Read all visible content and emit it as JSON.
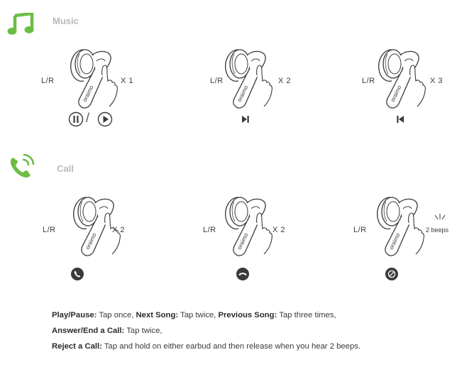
{
  "music": {
    "title": "Music",
    "items": [
      {
        "side": "L/R",
        "count": "X 1",
        "control": "pause-play"
      },
      {
        "side": "L/R",
        "count": "X 2",
        "control": "next"
      },
      {
        "side": "L/R",
        "count": "X 3",
        "control": "previous"
      }
    ],
    "separator": "/"
  },
  "call": {
    "title": "Call",
    "items": [
      {
        "side": "L/R",
        "count": "X 2",
        "control": "answer"
      },
      {
        "side": "L/R",
        "count": "X 2",
        "control": "end"
      },
      {
        "side": "L/R",
        "count": "2 beeps",
        "control": "reject"
      }
    ]
  },
  "earbud_brand": "oraimo",
  "description": {
    "line1": [
      {
        "label": "Play/Pause:",
        "text": " Tap once, "
      },
      {
        "label": "Next Song:",
        "text": " Tap twice, "
      },
      {
        "label": "Previous Song:",
        "text": " Tap three times,"
      }
    ],
    "line2": [
      {
        "label": "Answer/End a Call:",
        "text": " Tap twice,"
      }
    ],
    "line3": [
      {
        "label": "Reject a Call:",
        "text": " Tap and hold on either earbud and then release when you hear 2 beeps."
      }
    ]
  },
  "colors": {
    "accent_green": "#6cbd45",
    "icon_dark": "#3a3a3a",
    "title_gray": "#b9b9b9"
  }
}
